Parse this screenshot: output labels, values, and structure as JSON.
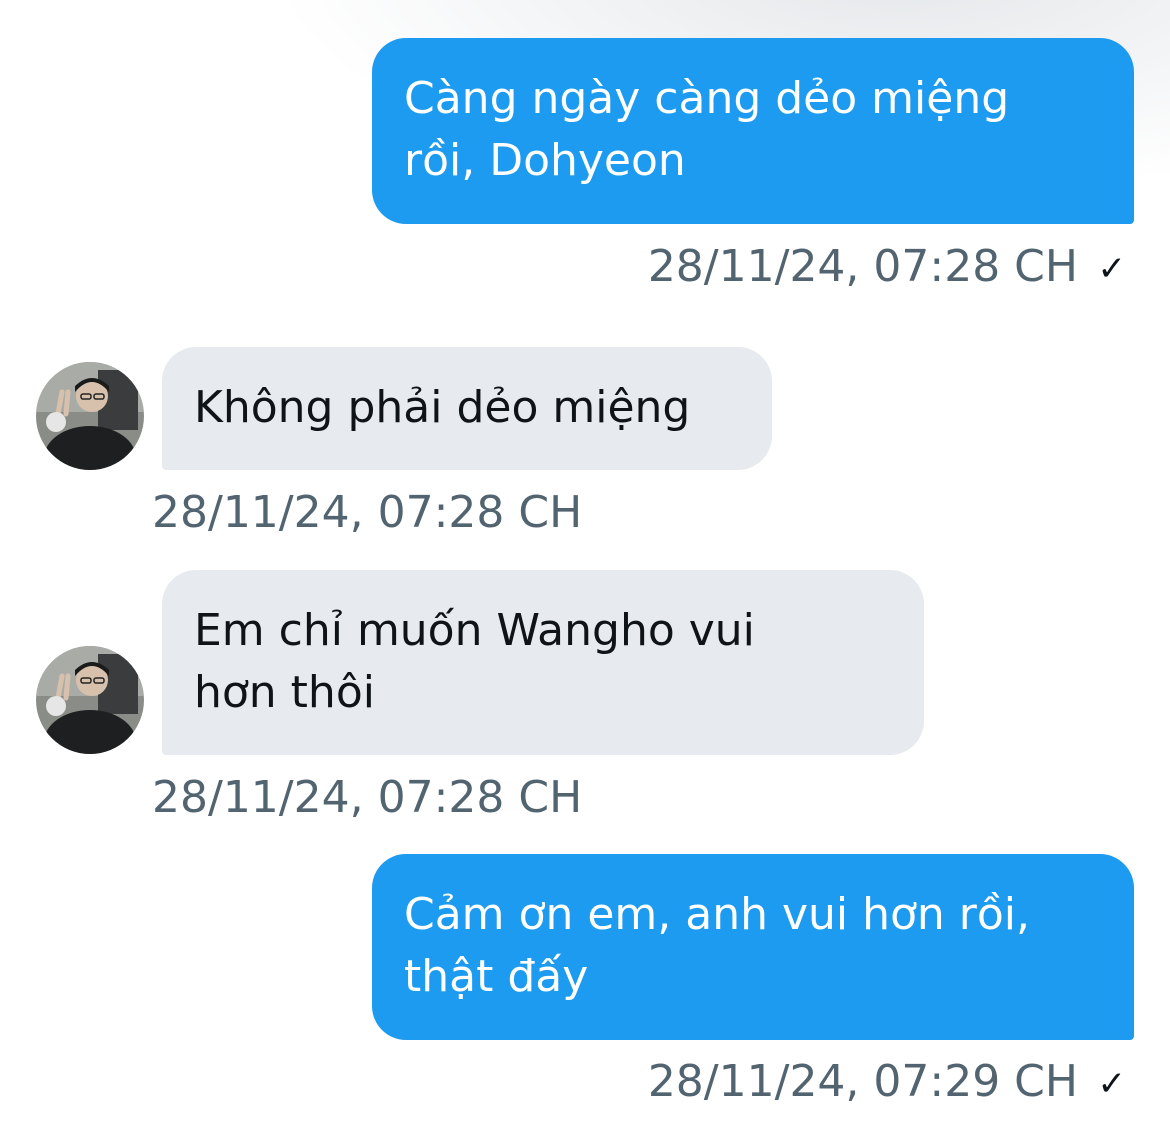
{
  "messages": [
    {
      "direction": "outgoing",
      "text": "Càng ngày càng dẻo miệng\nrồi, Dohyeon",
      "timestamp": "28/11/24, 07:28 CH",
      "status_icon": "checkmark-icon"
    },
    {
      "direction": "incoming",
      "text": "Không phải dẻo miệng",
      "timestamp": "28/11/24, 07:28 CH",
      "avatar_icon": "avatar"
    },
    {
      "direction": "incoming",
      "text": "Em chỉ muốn Wangho vui\nhơn thôi",
      "timestamp": "28/11/24, 07:28 CH",
      "avatar_icon": "avatar"
    },
    {
      "direction": "outgoing",
      "text": "Cảm ơn em, anh vui hơn rồi,\nthật đấy",
      "timestamp": "28/11/24, 07:29 CH",
      "status_icon": "checkmark-icon"
    }
  ],
  "status_glyph": "✓",
  "colors": {
    "outgoing_bubble": "#1d9bf0",
    "incoming_bubble": "#e7eaee",
    "timestamp_text": "#536471"
  }
}
